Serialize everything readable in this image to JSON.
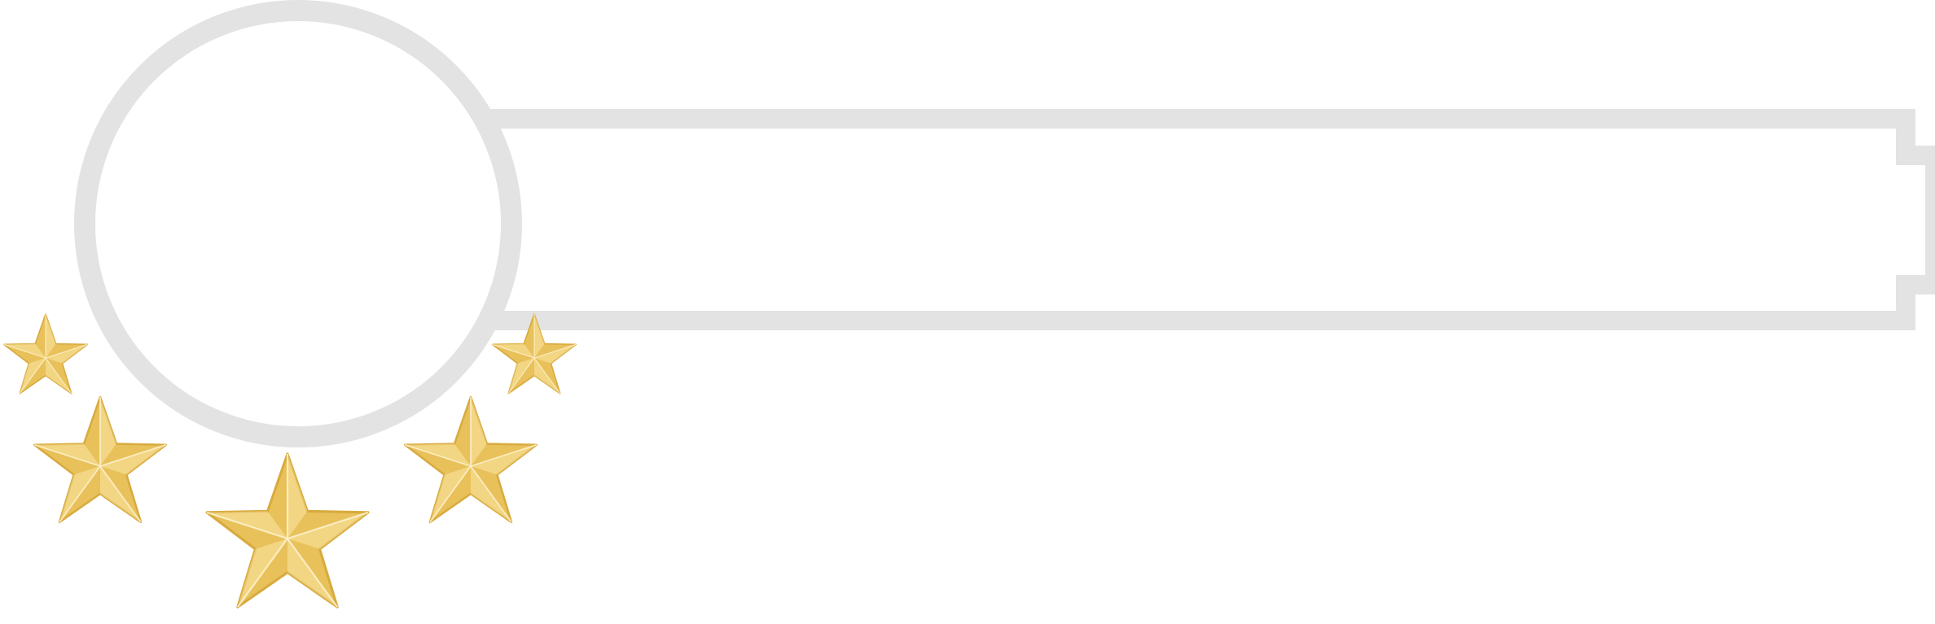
{
  "badge": {
    "frame_color": "#e3e3e3",
    "star_color": "#eec865",
    "star_highlight": "#f9e6a8",
    "star_shadow": "#d9ab3e",
    "background": "#ffffff",
    "rating": {
      "stars": 5,
      "label_text": ""
    }
  }
}
